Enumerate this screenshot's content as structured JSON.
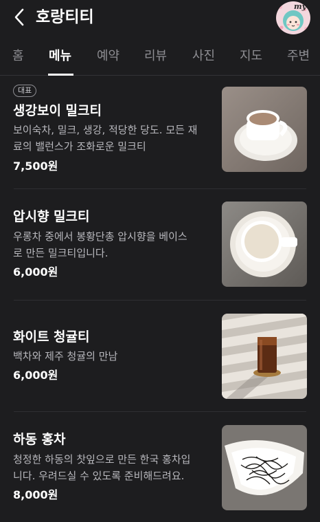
{
  "header": {
    "title": "호랑티티",
    "back_icon": "chevron-left-icon",
    "avatar_label": "my"
  },
  "tabs": [
    {
      "label": "홈",
      "active": false
    },
    {
      "label": "메뉴",
      "active": true
    },
    {
      "label": "예약",
      "active": false
    },
    {
      "label": "리뷰",
      "active": false
    },
    {
      "label": "사진",
      "active": false
    },
    {
      "label": "지도",
      "active": false
    },
    {
      "label": "주변",
      "active": false
    }
  ],
  "menu": {
    "items": [
      {
        "badge": "대표",
        "name": "생강보이 밀크티",
        "desc_lines": [
          "보이숙차, 밀크, 생강, 적당한 당도. 모든 재",
          "료의 밸런스가 조화로운 밀크티"
        ],
        "price": "7,500원",
        "photo": "milk-tea-cup-photo"
      },
      {
        "name": "압시향 밀크티",
        "desc_lines": [
          "우롱차 중에서 봉황단총 압시향을 베이스",
          "로 만든 밀크티입니다."
        ],
        "price": "6,000원",
        "photo": "milk-tea-top-view-photo"
      },
      {
        "name": "화이트 청귤티",
        "desc_lines": [
          "백차와 제주 청귤의 만남"
        ],
        "price": "6,000원",
        "photo": "iced-tea-glass-photo"
      },
      {
        "name": "하동 홍차",
        "desc_lines": [
          "청정한 하동의 찻잎으로 만든 한국 홍차입",
          "니다. 우려드실 수 있도록 준비해드려요."
        ],
        "price": "8,000원",
        "photo": "black-tea-leaves-photo"
      }
    ]
  },
  "colors": {
    "background": "#1d1d1f",
    "text_primary": "#ffffff",
    "text_secondary": "#b8b8bd",
    "tab_inactive": "#8e8e93"
  }
}
